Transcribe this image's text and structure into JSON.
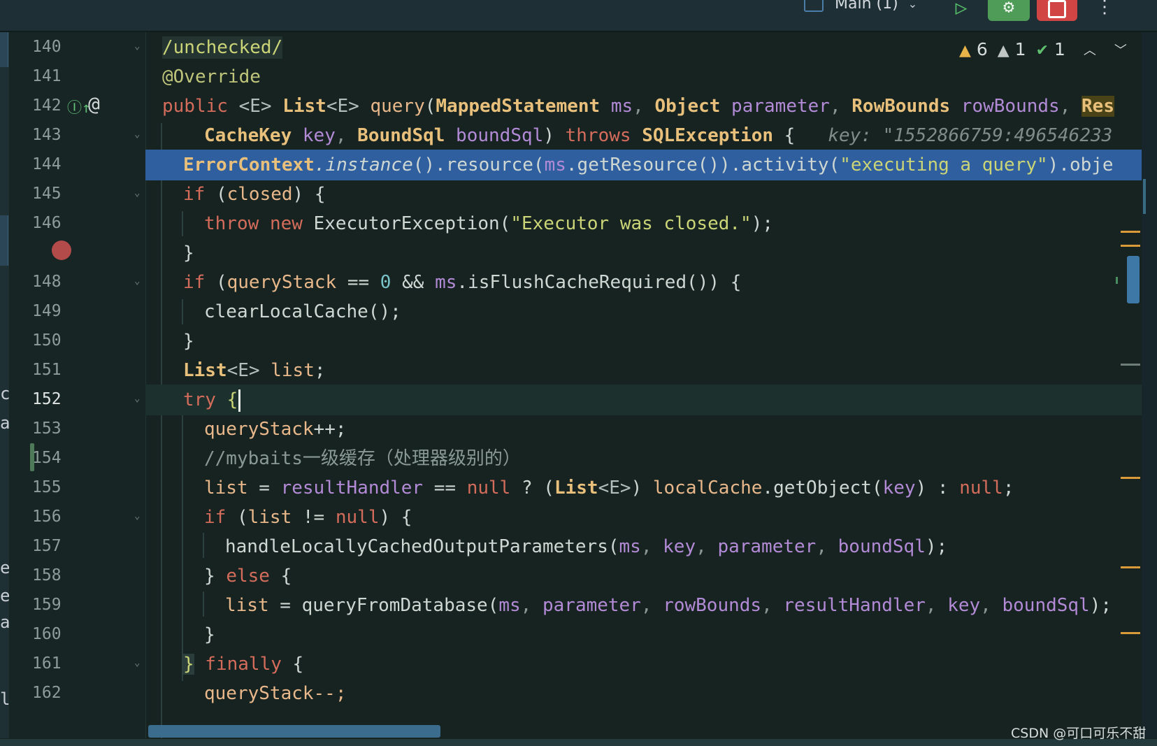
{
  "toolbar": {
    "run_config": "Main (1)",
    "play_icon": "▷",
    "debug_icon": "⚙",
    "more_icon": "⋮"
  },
  "inspections": {
    "warnings": "6",
    "weak_warnings": "1",
    "typos": "1"
  },
  "gutter": {
    "line_numbers": [
      "140",
      "141",
      "142",
      "143",
      "144",
      "145",
      "146",
      "148",
      "149",
      "150",
      "151",
      "152",
      "153",
      "154",
      "155",
      "156",
      "157",
      "158",
      "159",
      "160",
      "161",
      "162"
    ]
  },
  "left_strip": {
    "fragments": [
      "ce",
      "at",
      "e",
      "e",
      "a",
      "le"
    ]
  },
  "code": {
    "l140": "/unchecked/",
    "l141": "@Override",
    "l142": {
      "kw": "public",
      "tp1": " <E> ",
      "t1": "List",
      "tp2": "<E> ",
      "m": "query",
      "o": "(",
      "t2": "MappedStatement",
      "p1": " ms",
      "c1": ", ",
      "t3": "Object",
      "p2": " parameter",
      "c2": ", ",
      "t4": "RowBounds",
      "p3": " rowBounds",
      "c3": ", ",
      "t5": "Res"
    },
    "l143": {
      "t1": "CacheKey",
      "p1": " key",
      "c1": ", ",
      "t2": "BoundSql",
      "p2": " boundSql",
      "c2": ") ",
      "kw": "throws",
      "sp": " ",
      "t3": "SQLException",
      "c3": " {   ",
      "hint": "key: \"1552866759:496546233"
    },
    "l144": {
      "t": "ErrorContext",
      "i": ".instance",
      "m1": "().resource(",
      "p": "ms",
      "m2": ".getResource()).activity(",
      "s": "\"executing a query\"",
      "m3": ").obje"
    },
    "l145": {
      "kw": "if",
      "o": " (",
      "f": "closed",
      "c": ") {"
    },
    "l146": {
      "kw1": "throw",
      "sp": " ",
      "kw2": "new",
      "m": " ExecutorException(",
      "s": "\"Executor was closed.\"",
      "c": ");"
    },
    "l147": "}",
    "l148": {
      "kw": "if",
      "o": " (",
      "f": "queryStack",
      "m": " == ",
      "n": "0",
      "m2": " && ",
      "p": "ms",
      "m3": ".isFlushCacheRequired()) {"
    },
    "l149": "clearLocalCache();",
    "l150": "}",
    "l151": {
      "t": "List",
      "tp": "<E> ",
      "f": "list",
      "c": ";"
    },
    "l152": {
      "kw": "try",
      "b": " {"
    },
    "l153": {
      "f": "queryStack",
      "c": "++;"
    },
    "l154": "//mybaits一级缓存（处理器级别的）",
    "l155": {
      "f": "list",
      "m": " = ",
      "f2": "resultHandler",
      "m2": " == ",
      "k": "null",
      "m3": " ? (",
      "t": "List",
      "tp": "<E>",
      "m4": ") ",
      "f3": "localCache",
      "m5": ".getObject(",
      "p": "key",
      "m6": ") : ",
      "k2": "null",
      "c": ";"
    },
    "l156": {
      "kw": "if",
      "o": " (",
      "f": "list",
      "m": " != ",
      "k": "null",
      "c": ") {"
    },
    "l157": {
      "m": "handleLocallyCachedOutputParameters(",
      "p1": "ms",
      "c1": ", ",
      "p2": "key",
      "c2": ", ",
      "p3": "parameter",
      "c3": ", ",
      "p4": "boundSql",
      "c4": ");"
    },
    "l158": {
      "b": "} ",
      "kw": "else",
      "c": " {"
    },
    "l159": {
      "f": "list",
      "m": " = queryFromDatabase(",
      "p1": "ms",
      "c1": ", ",
      "p2": "parameter",
      "c2": ", ",
      "p3": "rowBounds",
      "c3": ", ",
      "p4": "resultHandler",
      "c4": ", ",
      "p5": "key",
      "c5": ", ",
      "p6": "boundSql",
      "c6": ");"
    },
    "l160": "}",
    "l161": {
      "b": "}",
      "kw": " finally",
      "c": " {"
    },
    "l162": "queryStack--;"
  },
  "watermark": "CSDN @可口可乐不甜"
}
